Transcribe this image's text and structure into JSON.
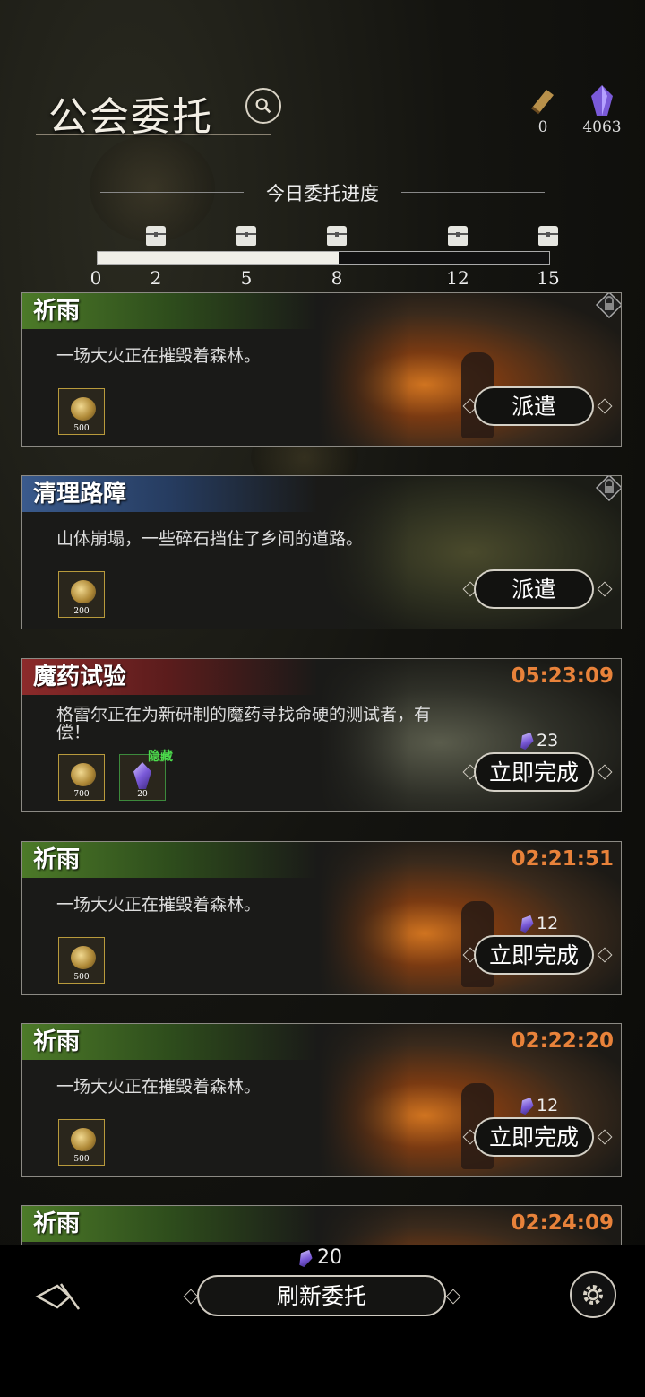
{
  "header": {
    "title": "公会委托",
    "resources": [
      {
        "icon": "scroll-icon",
        "value": "0"
      },
      {
        "icon": "crystal-icon",
        "value": "4063"
      }
    ]
  },
  "progress": {
    "title": "今日委托进度",
    "current": 8,
    "max": 15,
    "ticks": [
      "0",
      "2",
      "5",
      "8",
      "12",
      "15"
    ]
  },
  "cards": [
    {
      "title": "祈雨",
      "color": "#4c7a28",
      "desc": "一场大火正在摧毁着森林。",
      "rewards": [
        {
          "type": "ore",
          "amount": "500"
        }
      ],
      "action": "派遣",
      "locked": true
    },
    {
      "title": "清理路障",
      "color": "#3a5a8c",
      "desc": "山体崩塌，一些碎石挡住了乡间的道路。",
      "rewards": [
        {
          "type": "ore",
          "amount": "200"
        }
      ],
      "action": "派遣",
      "locked": true
    },
    {
      "title": "魔药试验",
      "color": "#8c2a2a",
      "desc": "格雷尔正在为新研制的魔药寻找命硬的测试者，有偿！",
      "rewards": [
        {
          "type": "ore",
          "amount": "700"
        },
        {
          "type": "gem",
          "amount": "20"
        }
      ],
      "hidden_tag": "隐藏",
      "timer": "05:23:09",
      "cost": "23",
      "action": "立即完成"
    },
    {
      "title": "祈雨",
      "color": "#4c7a28",
      "desc": "一场大火正在摧毁着森林。",
      "rewards": [
        {
          "type": "ore",
          "amount": "500"
        }
      ],
      "timer": "02:21:51",
      "cost": "12",
      "action": "立即完成"
    },
    {
      "title": "祈雨",
      "color": "#4c7a28",
      "desc": "一场大火正在摧毁着森林。",
      "rewards": [
        {
          "type": "ore",
          "amount": "500"
        }
      ],
      "timer": "02:22:20",
      "cost": "12",
      "action": "立即完成"
    },
    {
      "title": "祈雨",
      "color": "#4c7a28",
      "timer": "02:24:09"
    }
  ],
  "footer": {
    "refresh_cost": "20",
    "refresh_label": "刷新委托"
  }
}
